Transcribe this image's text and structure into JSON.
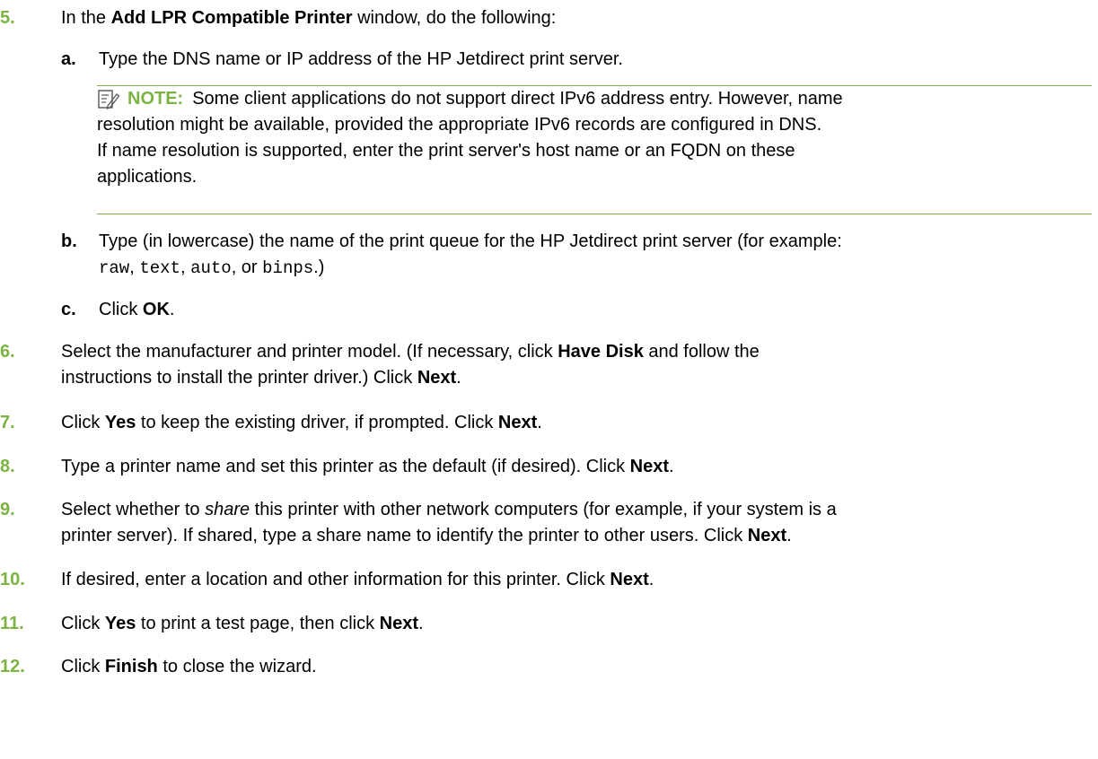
{
  "colors": {
    "accent": "#7cb342",
    "text": "#000000"
  },
  "note_icon": "note-pencil-icon",
  "step5": {
    "num": "5.",
    "pre": "In the ",
    "bold": "Add LPR Compatible Printer",
    "post": " window, do the following:",
    "a": {
      "letter": "a.",
      "text": "Type the DNS name or IP address of the HP Jetdirect print server."
    },
    "note": {
      "label": "NOTE:",
      "line1": "Some client applications do not support direct IPv6 address entry. However, name",
      "line2": "resolution might be available, provided the appropriate IPv6 records are configured in DNS.",
      "line3": "If name resolution is supported, enter the print server's host name or an FQDN on these",
      "line4": "applications."
    },
    "b": {
      "letter": "b.",
      "line1": "Type (in lowercase) the name of the print queue for the HP Jetdirect print server (for example:",
      "code1": "raw",
      "sep1": ", ",
      "code2": "text",
      "sep2": ", ",
      "code3": "auto",
      "sep3": ", or ",
      "code4": "binps",
      "end": ".)"
    },
    "c": {
      "letter": "c.",
      "pre": "Click ",
      "bold": "OK",
      "post": "."
    }
  },
  "step6": {
    "num": "6.",
    "t1": "Select the manufacturer and printer model. (If necessary, click ",
    "b1": "Have Disk",
    "t2": " and follow the",
    "t3": "instructions to install the printer driver.) Click ",
    "b2": "Next",
    "t4": "."
  },
  "step7": {
    "num": "7.",
    "t1": "Click ",
    "b1": "Yes",
    "t2": " to keep the existing driver, if prompted. Click ",
    "b2": "Next",
    "t3": "."
  },
  "step8": {
    "num": "8.",
    "t1": "Type a printer name and set this printer as the default (if desired). Click ",
    "b1": "Next",
    "t2": "."
  },
  "step9": {
    "num": "9.",
    "t1": "Select whether to ",
    "i1": "share",
    "t2": " this printer with other network computers (for example, if your system is a",
    "t3": "printer server). If shared, type a share name to identify the printer to other users. Click ",
    "b1": "Next",
    "t4": "."
  },
  "step10": {
    "num": "10.",
    "t1": "If desired, enter a location and other information for this printer. Click ",
    "b1": "Next",
    "t2": "."
  },
  "step11": {
    "num": "11.",
    "t1": "Click ",
    "b1": "Yes",
    "t2": " to print a test page, then click ",
    "b2": "Next",
    "t3": "."
  },
  "step12": {
    "num": "12.",
    "t1": "Click ",
    "b1": "Finish",
    "t2": " to close the wizard."
  }
}
